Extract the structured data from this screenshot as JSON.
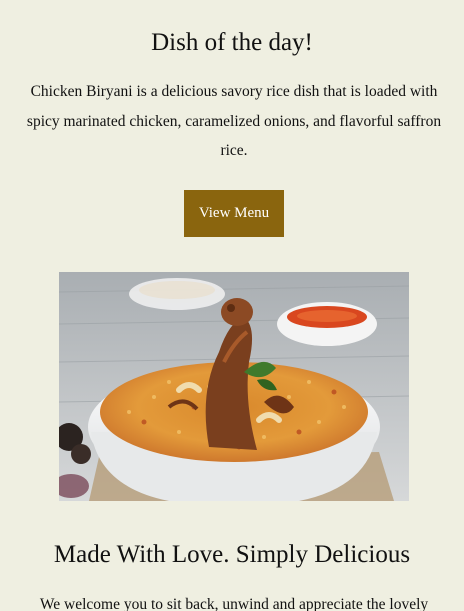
{
  "dish": {
    "title": "Dish of the day!",
    "description": "Chicken Biryani is a delicious savory rice dish that is loaded with spicy marinated chicken, caramelized onions, and flavorful saffron rice.",
    "button_label": "View Menu"
  },
  "colors": {
    "background": "#efefe1",
    "button": "#8a650e",
    "button_text": "#ffffff",
    "text": "#111111"
  },
  "about": {
    "heading": "Made With Love. Simply Delicious",
    "intro": "We welcome you to sit back, unwind and appreciate the lovely"
  }
}
